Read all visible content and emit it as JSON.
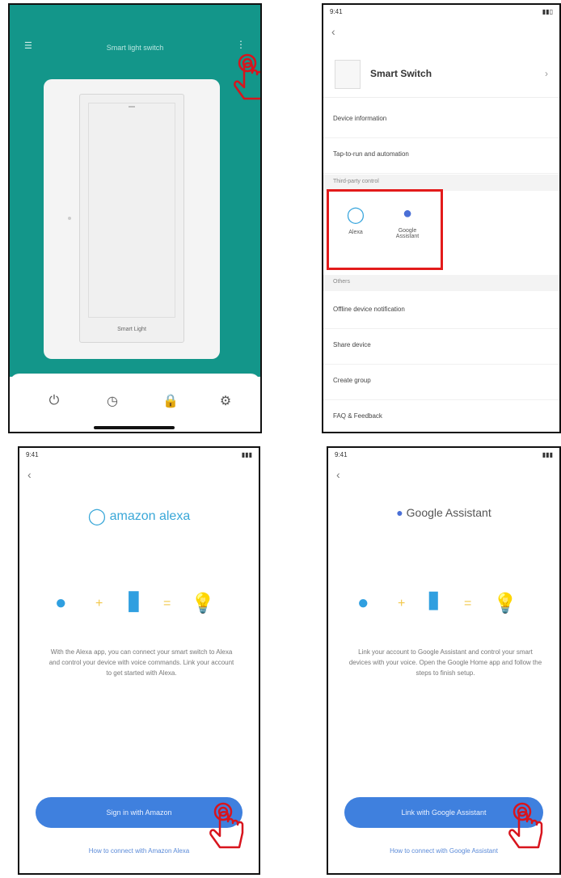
{
  "panel1": {
    "title": "Smart light switch",
    "switch_label": "Smart Light",
    "tabs": [
      {
        "icon": "power-icon",
        "glyph": "⏻"
      },
      {
        "icon": "timer-icon",
        "glyph": "◷"
      },
      {
        "icon": "lock-icon",
        "glyph": "🔒"
      },
      {
        "icon": "settings-icon",
        "glyph": "⚙"
      }
    ],
    "teal": "#13968a"
  },
  "panel2": {
    "status_time": "9:41",
    "device_name": "Smart Switch",
    "rows_top": [
      "Device information",
      "Tap-to-run and automation"
    ],
    "section_third_party": "Third-party control",
    "services": [
      {
        "name": "Alexa",
        "icon": "alexa-icon",
        "glyph": "◯"
      },
      {
        "name": "Google Assistant",
        "icon": "google-assistant-icon",
        "glyph": "●"
      }
    ],
    "section_others": "Others",
    "rows_bottom": [
      "Offline device notification",
      "Share device",
      "Create group",
      "FAQ & Feedback"
    ],
    "highlight": "#e31b1b"
  },
  "panel3": {
    "status_time": "9:41",
    "brand": "amazon alexa",
    "description": "With the Alexa app, you can connect your smart switch to Alexa and control your device with voice commands. Link your account to get started with Alexa.",
    "button": "Sign in with Amazon",
    "link": "How to connect with Amazon Alexa",
    "accent": "#3f80de"
  },
  "panel4": {
    "status_time": "9:41",
    "brand": "Google Assistant",
    "description": "Link your account to Google Assistant and control your smart devices with your voice. Open the Google Home app and follow the steps to finish setup.",
    "button": "Link with Google Assistant",
    "link": "How to connect with Google Assistant",
    "accent": "#3f80de"
  }
}
